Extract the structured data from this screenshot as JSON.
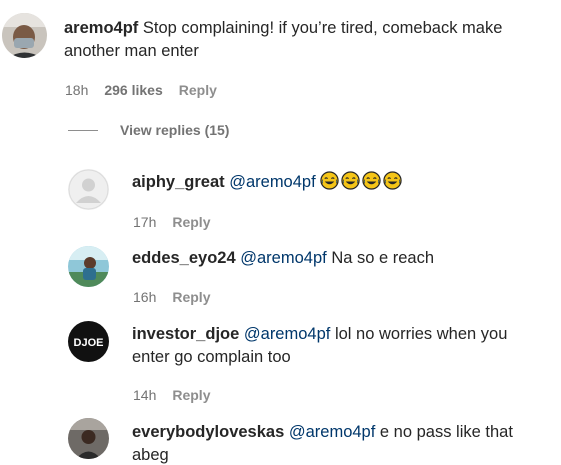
{
  "comments": [
    {
      "username": "aremo4pf",
      "mention": "",
      "text": "Stop complaining! if you’re tired, comeback make",
      "text_line2": "another man enter",
      "time": "18h",
      "likes": "296 likes",
      "reply": "Reply",
      "avatar": "person-with-face-mask-photo"
    }
  ],
  "view_replies": "View replies (15)",
  "replies": [
    {
      "username": "aiphy_great",
      "mention": "@aremo4pf",
      "text": "",
      "emojis": [
        "face-with-tears-of-joy",
        "face-with-tears-of-joy",
        "face-with-tears-of-joy",
        "face-with-tears-of-joy"
      ],
      "time": "17h",
      "reply": "Reply",
      "avatar": "default-avatar"
    },
    {
      "username": "eddes_eyo24",
      "mention": "@aremo4pf",
      "text": "Na so e reach",
      "time": "16h",
      "reply": "Reply",
      "avatar": "outdoor-photo"
    },
    {
      "username": "investor_djoe",
      "mention": "@aremo4pf",
      "text": "lol no worries when you",
      "text_line2": "enter go complain too",
      "time": "14h",
      "reply": "Reply",
      "avatar": "djoe-logo",
      "avatar_text": "DJOE"
    },
    {
      "username": "everybodyloveskas",
      "mention": "@aremo4pf",
      "text": "e no pass like that",
      "text_line2": "abeg",
      "time": "",
      "reply": "",
      "avatar": "person-photo"
    }
  ],
  "colors": {
    "mention": "#00376b",
    "meta": "#737373",
    "text": "#262626",
    "emoji": "#f5c518"
  }
}
